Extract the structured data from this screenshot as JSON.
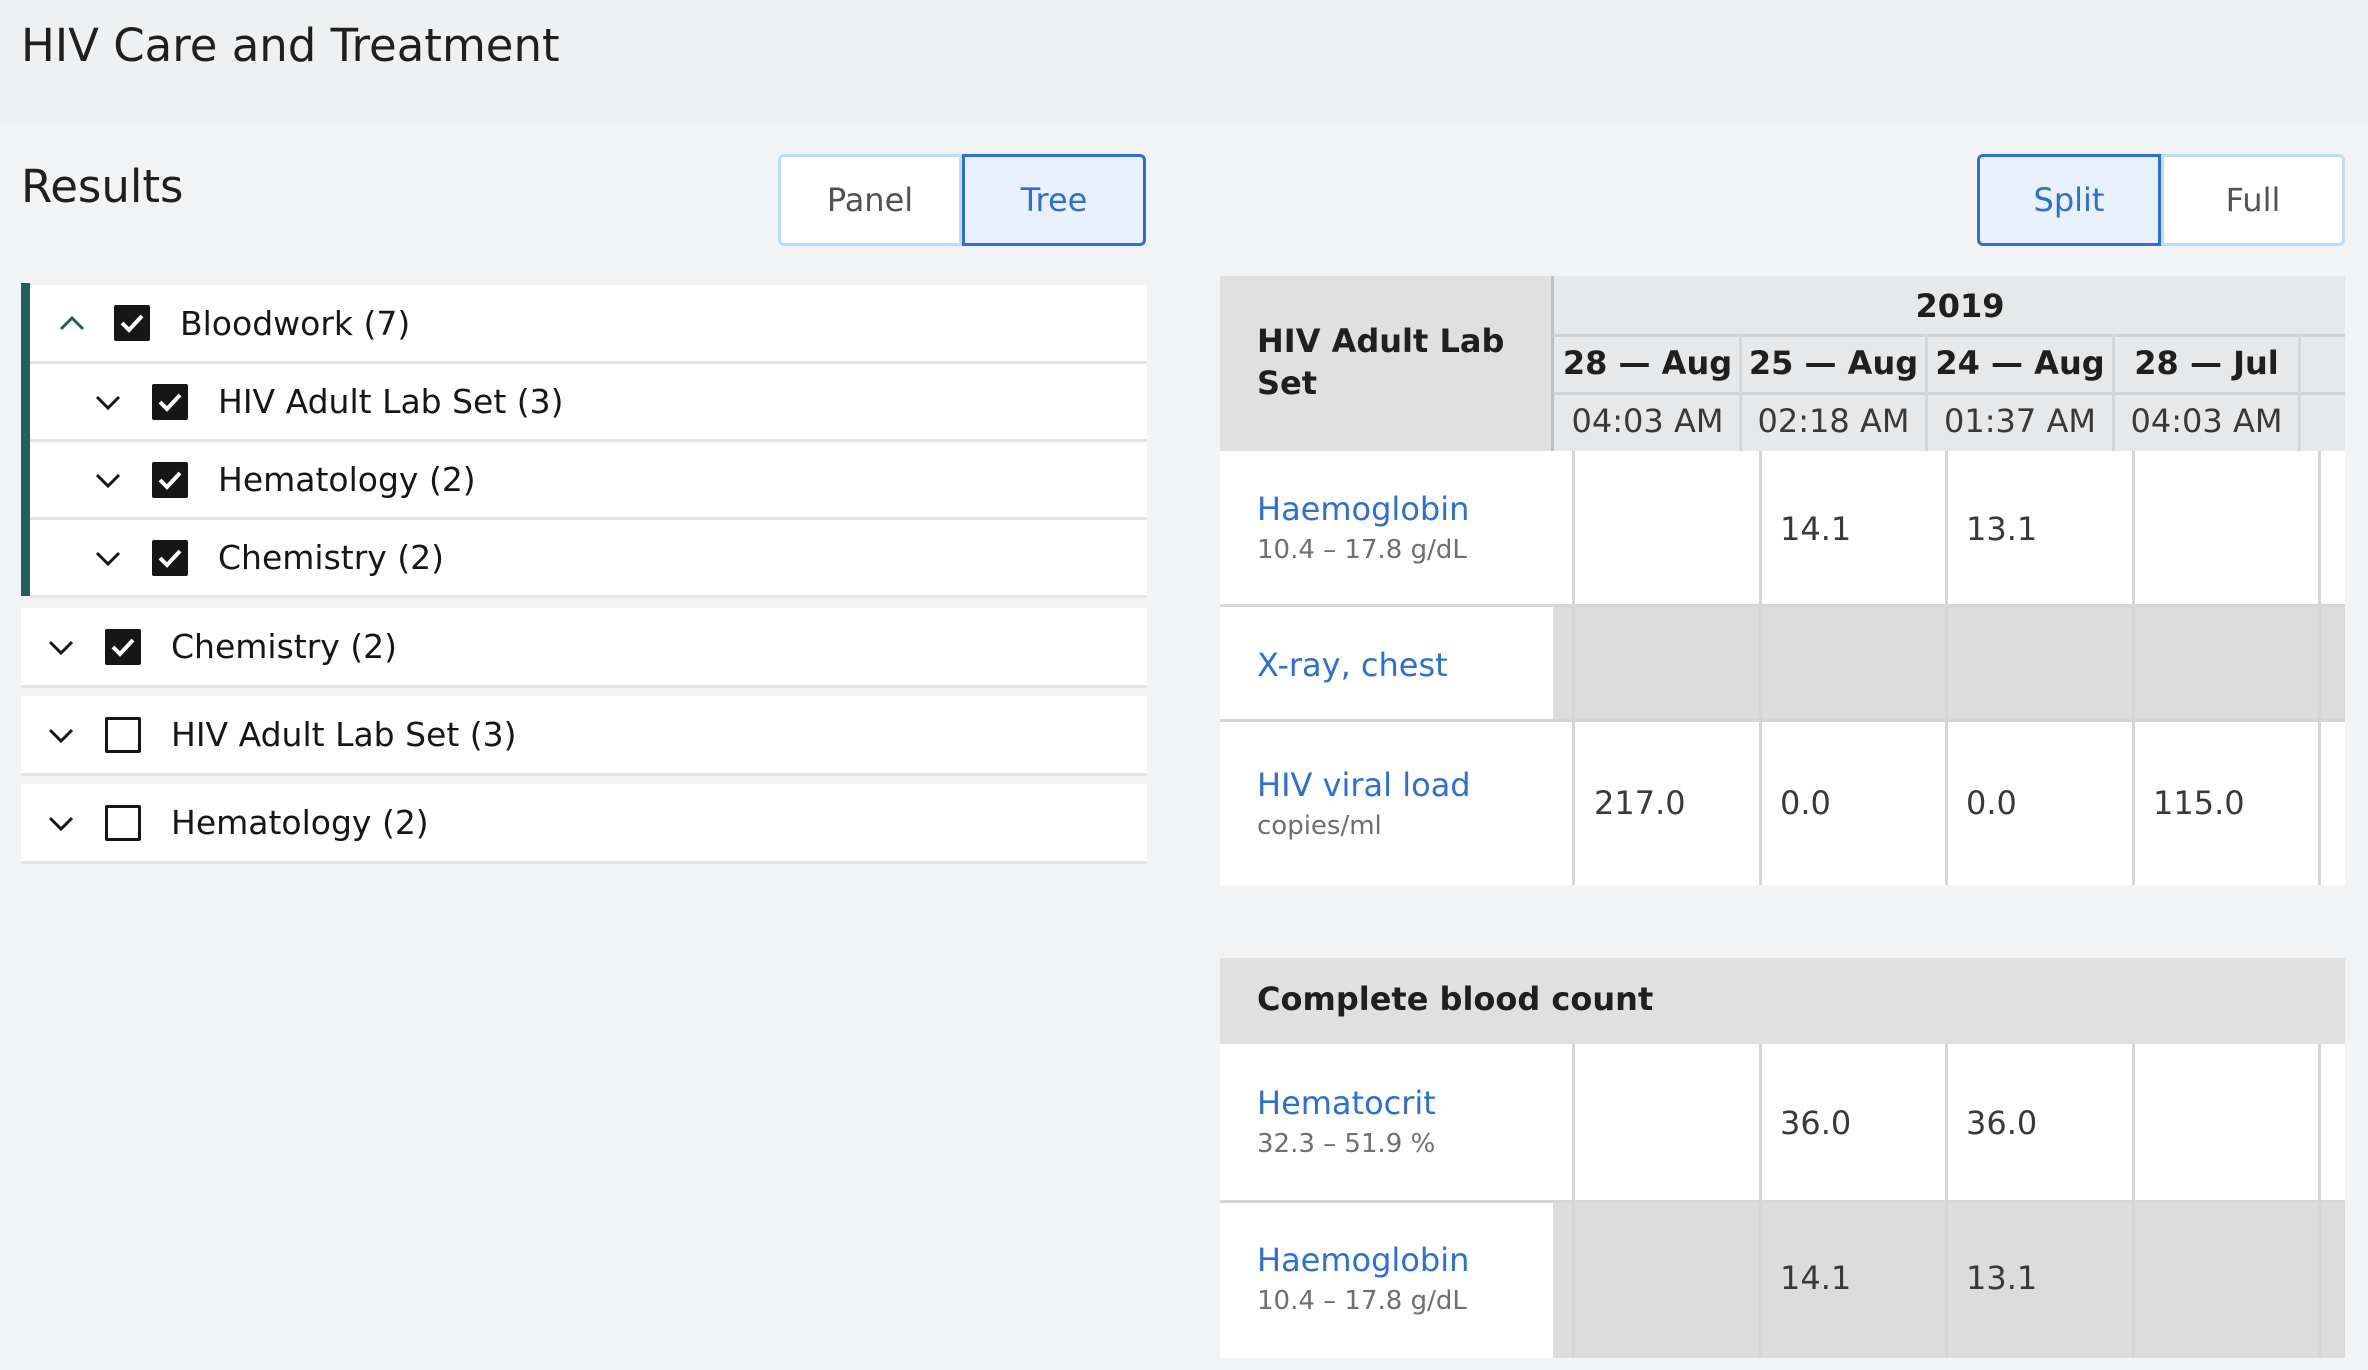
{
  "page_title": "HIV Care and Treatment",
  "results_title": "Results",
  "view_toggle": {
    "panel_label": "Panel",
    "tree_label": "Tree",
    "active": "Tree"
  },
  "layout_toggle": {
    "split_label": "Split",
    "full_label": "Full",
    "active": "Split"
  },
  "tree": {
    "items": [
      {
        "label": "Bloodwork (7)",
        "checked": true,
        "expanded": true
      },
      {
        "label": "HIV Adult Lab Set (3)",
        "checked": true,
        "expanded": false
      },
      {
        "label": "Hematology (2)",
        "checked": true,
        "expanded": false
      },
      {
        "label": "Chemistry (2)",
        "checked": true,
        "expanded": false
      },
      {
        "label": "Chemistry (2)",
        "checked": true,
        "expanded": false
      },
      {
        "label": "HIV Adult Lab Set (3)",
        "checked": false,
        "expanded": false
      },
      {
        "label": "Hematology (2)",
        "checked": false,
        "expanded": false
      }
    ]
  },
  "panel1": {
    "title": "HIV Adult Lab Set",
    "year": "2019",
    "columns": [
      {
        "date": "28 — Aug",
        "time": "04:03 AM"
      },
      {
        "date": "25 — Aug",
        "time": "02:18 AM"
      },
      {
        "date": "24 — Aug",
        "time": "01:37 AM"
      },
      {
        "date": "28 — Jul",
        "time": "04:03 AM"
      }
    ],
    "rows": [
      {
        "name": "Haemoglobin",
        "range": "10.4 – 17.8 g/dL",
        "values": [
          "",
          "14.1",
          "13.1",
          ""
        ]
      },
      {
        "name": "X-ray, chest",
        "range": "",
        "values": [
          "",
          "",
          "",
          ""
        ]
      },
      {
        "name": "HIV viral load",
        "range": "copies/ml",
        "values": [
          "217.0",
          "0.0",
          "0.0",
          "115.0"
        ]
      }
    ]
  },
  "panel2": {
    "title": "Complete blood count",
    "rows": [
      {
        "name": "Hematocrit",
        "range": "32.3 – 51.9 %",
        "values": [
          "",
          "36.0",
          "36.0",
          ""
        ]
      },
      {
        "name": "Haemoglobin",
        "range": "10.4 – 17.8 g/dL",
        "values": [
          "",
          "14.1",
          "13.1",
          ""
        ]
      }
    ]
  },
  "colors": {
    "accent": "#2d6fd6",
    "tree_accent": "#22605f"
  }
}
